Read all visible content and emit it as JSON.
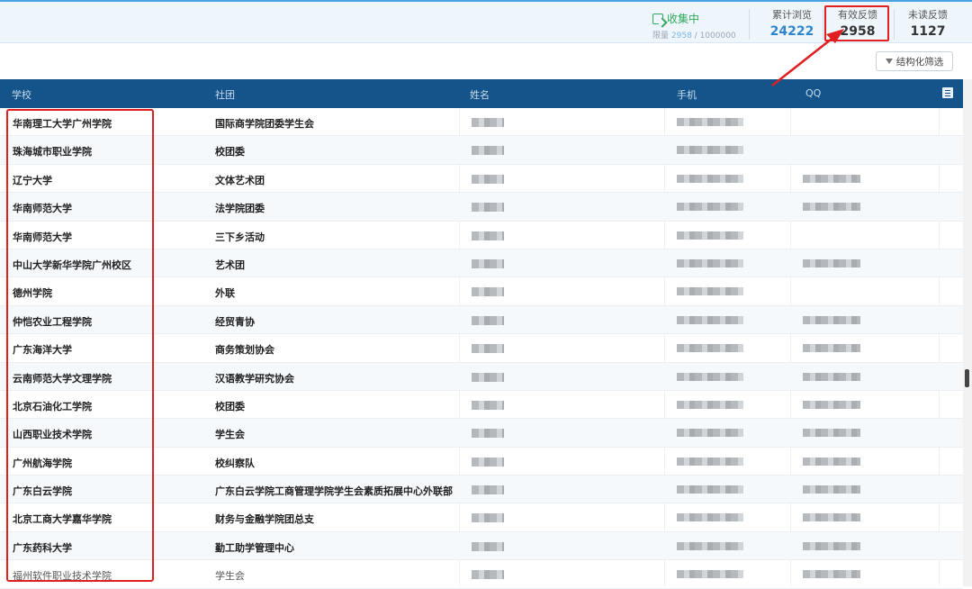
{
  "header": {
    "collect_status": "收集中",
    "limit_label": "限量",
    "limit_used": "2958",
    "limit_total": "/ 1000000",
    "stats": [
      {
        "label": "累计浏览",
        "value": "24222"
      },
      {
        "label": "有效反馈",
        "value": "2958"
      },
      {
        "label": "未读反馈",
        "value": "1127"
      }
    ],
    "filter_button": "结构化筛选"
  },
  "table": {
    "columns": [
      "学校",
      "社团",
      "姓名",
      "手机",
      "QQ"
    ],
    "rows": [
      {
        "school": "华南理工大学广州学院",
        "club": "国际商学院团委学生会",
        "qq": false
      },
      {
        "school": "珠海城市职业学院",
        "club": "校团委",
        "qq": false
      },
      {
        "school": "辽宁大学",
        "club": "文体艺术团",
        "qq": true
      },
      {
        "school": "华南师范大学",
        "club": "法学院团委",
        "qq": true
      },
      {
        "school": "华南师范大学",
        "club": "三下乡活动",
        "qq": false
      },
      {
        "school": "中山大学新华学院广州校区",
        "club": "艺术团",
        "qq": true
      },
      {
        "school": "德州学院",
        "club": "外联",
        "qq": false
      },
      {
        "school": "仲恺农业工程学院",
        "club": "经贸青协",
        "qq": true
      },
      {
        "school": "广东海洋大学",
        "club": "商务策划协会",
        "qq": true
      },
      {
        "school": "云南师范大学文理学院",
        "club": "汉语教学研究协会",
        "qq": true
      },
      {
        "school": "北京石油化工学院",
        "club": "校团委",
        "qq": true
      },
      {
        "school": "山西职业技术学院",
        "club": "学生会",
        "qq": true
      },
      {
        "school": "广州航海学院",
        "club": "校纠察队",
        "qq": true
      },
      {
        "school": "广东白云学院",
        "club": "广东白云学院工商管理学院学生会素质拓展中心外联部",
        "qq": true
      },
      {
        "school": "北京工商大学嘉华学院",
        "club": "财务与金融学院团总支",
        "qq": true
      },
      {
        "school": "广东药科大学",
        "club": "勤工助学管理中心",
        "qq": true
      },
      {
        "school": "福州软件职业技术学院",
        "club": "学生会",
        "qq": true
      }
    ]
  },
  "colors": {
    "header_bg": "#14548a",
    "accent_green": "#2fa85a",
    "accent_blue": "#2f86cf",
    "highlight_red": "#e02020"
  }
}
